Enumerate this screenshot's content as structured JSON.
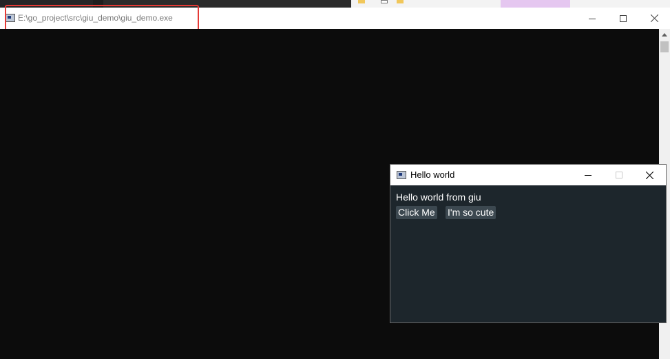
{
  "console_window": {
    "title": "E:\\go_project\\src\\giu_demo\\giu_demo.exe",
    "buttons": {
      "minimize": "minimize-icon",
      "maximize": "maximize-icon",
      "close": "close-icon"
    }
  },
  "hello_window": {
    "title": "Hello world",
    "text": "Hello world from giu",
    "buttons": [
      {
        "label": "Click Me"
      },
      {
        "label": "I'm so cute"
      }
    ]
  },
  "colors": {
    "console_bg": "#0c0c0c",
    "imgui_bg": "#1d262c",
    "imgui_button": "#3c4850",
    "highlight": "#e53935"
  }
}
